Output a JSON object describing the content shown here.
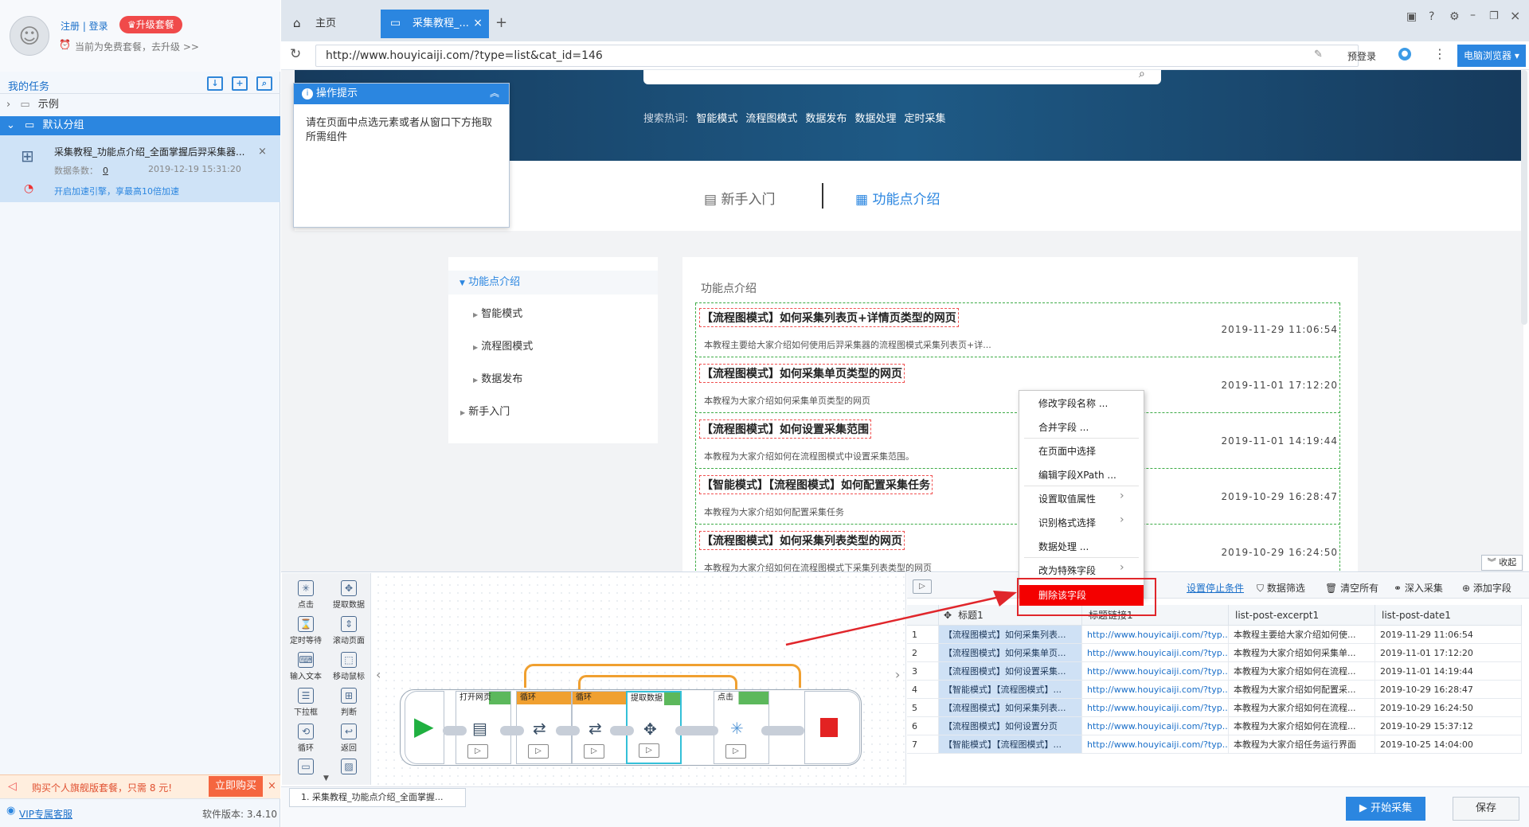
{
  "user": {
    "login_text": "注册 | 登录",
    "upgrade_label": "♛升级套餐",
    "plan_text": "当前为免费套餐，去升级 >>"
  },
  "sidebar": {
    "title": "我的任务",
    "groups": [
      {
        "label": "示例"
      },
      {
        "label": "默认分组"
      }
    ],
    "task": {
      "name": "采集教程_功能点介绍_全面掌握后羿采集器...",
      "count_label": "数据条数：",
      "count": "0",
      "time": "2019-12-19 15:31:20",
      "boost": "开启加速引擎，享最高10倍加速"
    },
    "promo": {
      "text": "购买个人旗舰版套餐，只需 8 元!",
      "buy_label": "立即购买"
    },
    "vip_link": "VIP专属客服",
    "version": "软件版本: 3.4.10"
  },
  "tabs": [
    {
      "label": "主页"
    },
    {
      "label": "采集教程_..."
    }
  ],
  "address": {
    "url": "http://www.houyicaiji.com/?type=list&cat_id=146",
    "prelogin": "预登录",
    "browser_label": "电脑浏览器"
  },
  "hero": {
    "hot_label": "搜索热词:",
    "hot_words": [
      "智能模式",
      "流程图模式",
      "数据发布",
      "数据处理",
      "定时采集"
    ]
  },
  "site_tabs": [
    "新手入门",
    "功能点介绍"
  ],
  "side_nav": {
    "title": "功能点介绍",
    "items": [
      "智能模式",
      "流程图模式",
      "数据发布"
    ],
    "extra": "新手入门"
  },
  "list": {
    "heading": "功能点介绍",
    "articles": [
      {
        "title": "【流程图模式】如何采集列表页+详情页类型的网页",
        "date": "2019-11-29 11:06:54",
        "desc": "本教程主要给大家介绍如何使用后羿采集器的流程图模式采集列表页+详..."
      },
      {
        "title": "【流程图模式】如何采集单页类型的网页",
        "date": "2019-11-01 17:12:20",
        "desc": "本教程为大家介绍如何采集单页类型的网页"
      },
      {
        "title": "【流程图模式】如何设置采集范围",
        "date": "2019-11-01 14:19:44",
        "desc": "本教程为大家介绍如何在流程图模式中设置采集范围。"
      },
      {
        "title": "【智能模式】【流程图模式】如何配置采集任务",
        "date": "2019-10-29 16:28:47",
        "desc": "本教程为大家介绍如何配置采集任务"
      },
      {
        "title": "【流程图模式】如何采集列表类型的网页",
        "date": "2019-10-29 16:24:50",
        "desc": "本教程为大家介绍如何在流程图模式下采集列表类型的网页"
      }
    ]
  },
  "tip": {
    "title": "操作提示",
    "text": "请在页面中点选元素或者从窗口下方拖取所需组件"
  },
  "context_menu": {
    "items": [
      "修改字段名称 ...",
      "合并字段 ...",
      "在页面中选择",
      "编辑字段XPath ...",
      "设置取值属性",
      "识别格式选择",
      "数据处理 ...",
      "改为特殊字段"
    ],
    "delete": "删除该字段"
  },
  "collapse_label": "收起",
  "palette": [
    {
      "label": "点击",
      "icon": "click-icon"
    },
    {
      "label": "提取数据",
      "icon": "extract-icon"
    },
    {
      "label": "定时等待",
      "icon": "hourglass-icon"
    },
    {
      "label": "滚动页面",
      "icon": "scroll-icon"
    },
    {
      "label": "输入文本",
      "icon": "input-icon"
    },
    {
      "label": "移动鼠标",
      "icon": "mouse-icon"
    },
    {
      "label": "下拉框",
      "icon": "dropdown-icon"
    },
    {
      "label": "判断",
      "icon": "branch-icon"
    },
    {
      "label": "循环",
      "icon": "loop-icon"
    },
    {
      "label": "返回",
      "icon": "back-icon"
    }
  ],
  "flow_nodes": [
    {
      "label": "打开网页",
      "color": "#5cb85c"
    },
    {
      "label": "循环",
      "color": "#f0a030"
    },
    {
      "label": "循环",
      "color": "#f0a030"
    },
    {
      "label": "提取数据",
      "color": "#5cb85c"
    },
    {
      "label": "点击",
      "color": "#5cb85c"
    }
  ],
  "data_toolbar": {
    "stop_cond": "设置停止条件",
    "filter": "数据筛选",
    "clear": "清空所有",
    "deep": "深入采集",
    "add_field": "添加字段"
  },
  "table": {
    "columns": [
      "标题1",
      "标题链接1",
      "list-post-excerpt1",
      "list-post-date1"
    ],
    "rows": [
      [
        "1",
        "【流程图模式】如何采集列表...",
        "http://www.houyicaiji.com/?typ...",
        "本教程主要给大家介绍如何使...",
        "2019-11-29 11:06:54"
      ],
      [
        "2",
        "【流程图模式】如何采集单页...",
        "http://www.houyicaiji.com/?typ...",
        "本教程为大家介绍如何采集单...",
        "2019-11-01 17:12:20"
      ],
      [
        "3",
        "【流程图模式】如何设置采集...",
        "http://www.houyicaiji.com/?typ...",
        "本教程为大家介绍如何在流程...",
        "2019-11-01 14:19:44"
      ],
      [
        "4",
        "【智能模式】【流程图模式】...",
        "http://www.houyicaiji.com/?typ...",
        "本教程为大家介绍如何配置采...",
        "2019-10-29 16:28:47"
      ],
      [
        "5",
        "【流程图模式】如何采集列表...",
        "http://www.houyicaiji.com/?typ...",
        "本教程为大家介绍如何在流程...",
        "2019-10-29 16:24:50"
      ],
      [
        "6",
        "【流程图模式】如何设置分页",
        "http://www.houyicaiji.com/?typ...",
        "本教程为大家介绍如何在流程...",
        "2019-10-29 15:37:12"
      ],
      [
        "7",
        "【智能模式】【流程图模式】...",
        "http://www.houyicaiji.com/?typ...",
        "本教程为大家介绍任务运行界面",
        "2019-10-25 14:04:00"
      ]
    ]
  },
  "footer": {
    "task_tab": "1. 采集教程_功能点介绍_全面掌握...",
    "start_label": "开始采集",
    "save_label": "保存"
  }
}
